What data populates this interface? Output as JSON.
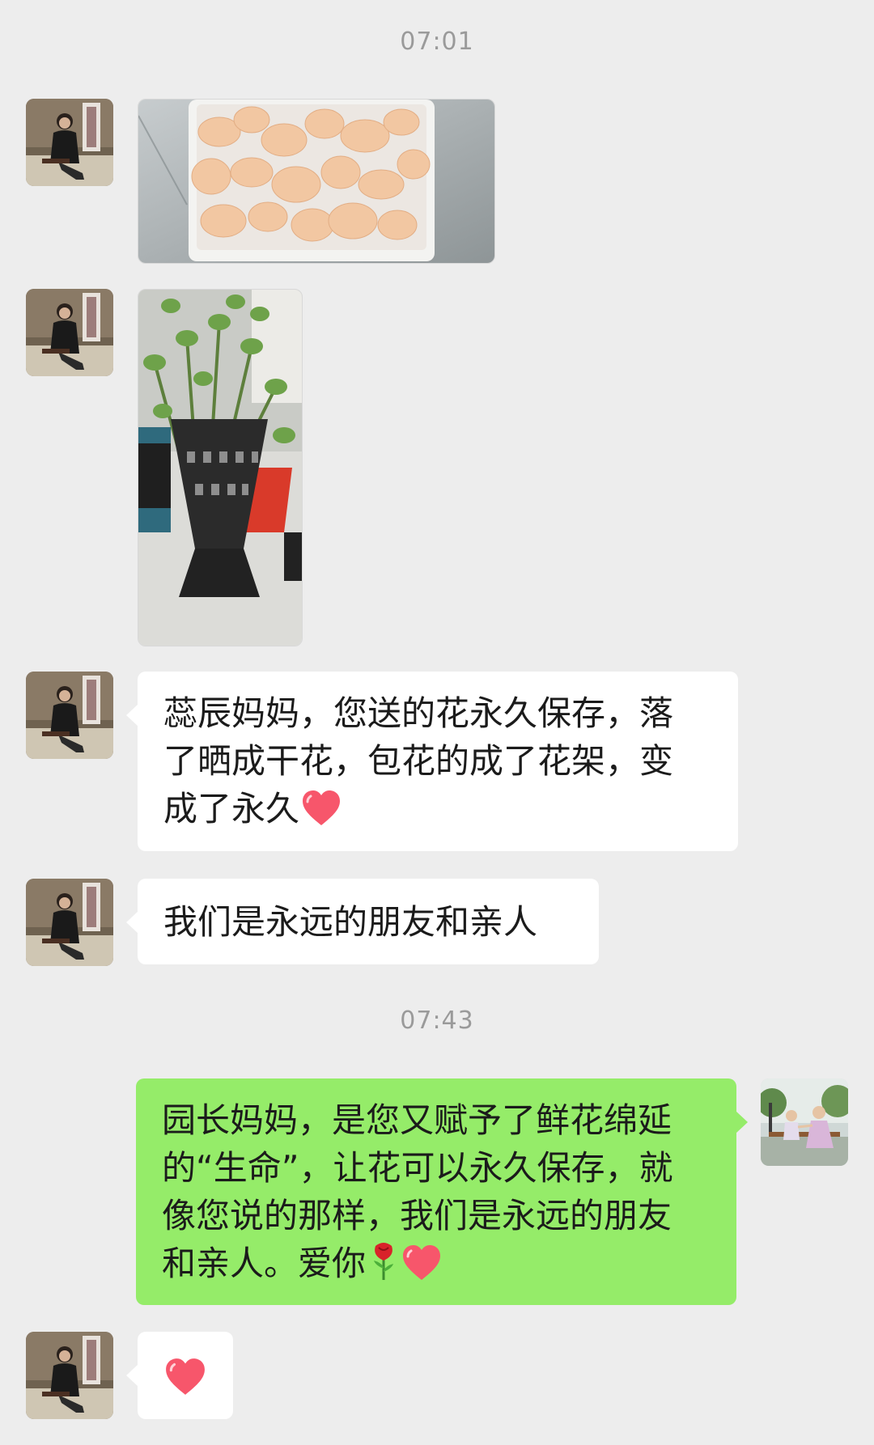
{
  "chat": {
    "timestamps": [
      "07:01",
      "07:43"
    ],
    "messages": [
      {
        "sender": "contact",
        "type": "image",
        "content": "dried rose petals in white tray"
      },
      {
        "sender": "contact",
        "type": "image",
        "content": "potted plants in black flower stand"
      },
      {
        "sender": "contact",
        "type": "text",
        "lines": [
          "蕊辰妈妈，您送的花永久保存，落",
          "了晒成干花，包花的成了花架，变",
          "成了永久"
        ],
        "trailing_emoji": "heart"
      },
      {
        "sender": "contact",
        "type": "text",
        "lines": [
          "我们是永远的朋友和亲人"
        ]
      },
      {
        "sender": "self",
        "type": "text",
        "lines": [
          "园长妈妈，是您又赋予了鲜花绵延",
          "的“生命”，让花可以永久保存，就",
          "像您说的那样，我们是永远的朋友",
          "和亲人。爱你"
        ],
        "trailing_emoji": [
          "rose",
          "heart"
        ]
      },
      {
        "sender": "contact",
        "type": "emoji",
        "content": "heart"
      }
    ]
  },
  "colors": {
    "background": "#ededed",
    "bubble_incoming": "#ffffff",
    "bubble_outgoing": "#95ec69",
    "timestamp_text": "#9a9a9a",
    "heart": "#f7566b"
  },
  "icons": {
    "contact_avatar": "woman-seated-avatar",
    "self_avatar": "children-in-park-avatar",
    "heart": "red-heart-emoji",
    "rose": "rose-emoji"
  }
}
